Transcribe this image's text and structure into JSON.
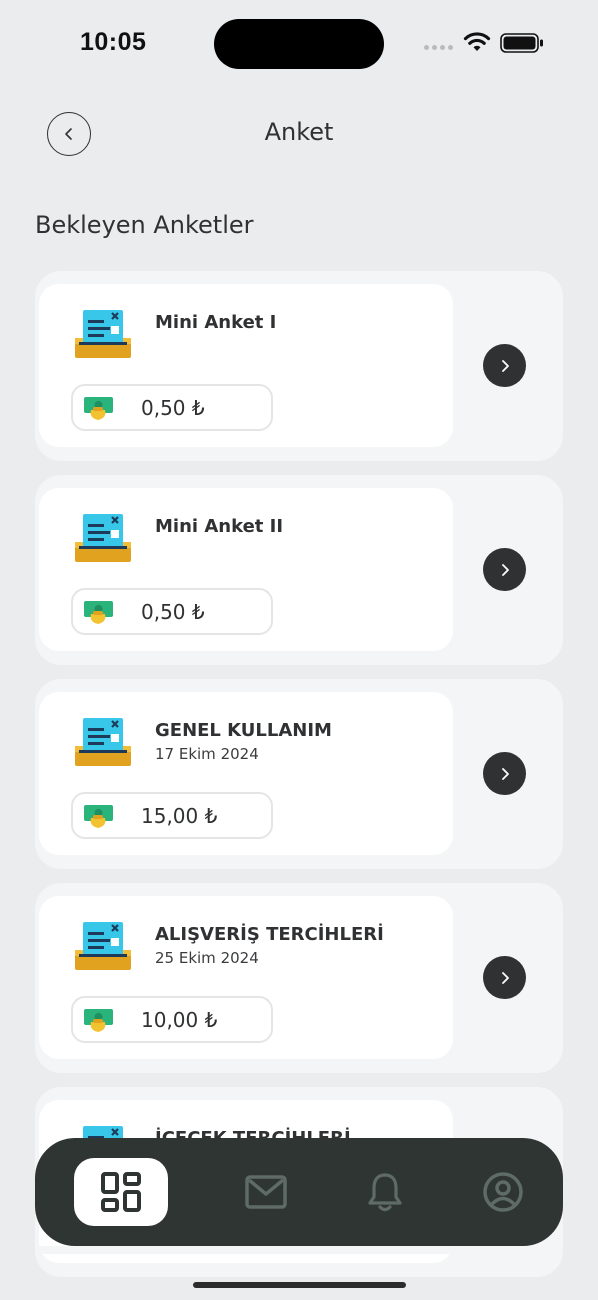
{
  "status_bar": {
    "time": "10:05"
  },
  "header": {
    "title": "Anket"
  },
  "section": {
    "title": "Bekleyen Anketler"
  },
  "surveys": [
    {
      "title": "Mini Anket I",
      "date": "",
      "reward": "0,50 ₺"
    },
    {
      "title": "Mini Anket II",
      "date": "",
      "reward": "0,50 ₺"
    },
    {
      "title": "GENEL KULLANIM",
      "date": "17 Ekim 2024",
      "reward": "15,00 ₺"
    },
    {
      "title": "ALIŞVERİŞ TERCİHLERİ",
      "date": "25 Ekim 2024",
      "reward": "10,00 ₺"
    },
    {
      "title": "İÇECEK TERCİHLERİ",
      "date": "",
      "reward": ""
    }
  ],
  "tab_bar": {
    "tabs": [
      {
        "icon": "grid-icon",
        "active": true
      },
      {
        "icon": "mail-icon",
        "active": false
      },
      {
        "icon": "bell-icon",
        "active": false
      },
      {
        "icon": "profile-icon",
        "active": false
      }
    ]
  },
  "colors": {
    "background": "#ebecee",
    "dark": "#2f3133",
    "tab_bar": "#2f3532",
    "icon_muted": "#5e6b66"
  }
}
